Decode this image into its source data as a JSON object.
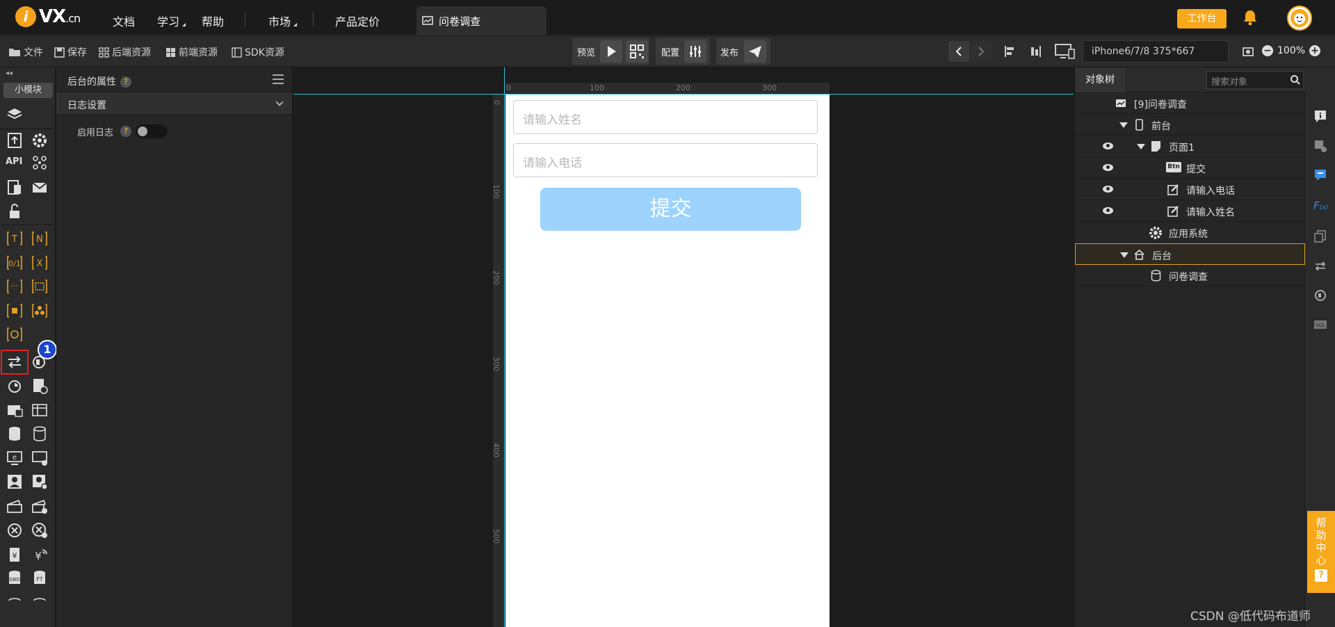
{
  "header": {
    "logo": {
      "mark": "i",
      "text": "VX",
      "suffix": ".cn"
    },
    "nav": [
      {
        "label": "文档"
      },
      {
        "label": "学习"
      },
      {
        "label": "帮助"
      },
      {
        "label": "市场"
      },
      {
        "label": "产品定价"
      }
    ],
    "active_tab": "问卷调查",
    "workbench_label": "工作台"
  },
  "toolbar": {
    "file_label": "文件",
    "save_label": "保存",
    "backend_resources_label": "后端资源",
    "frontend_resources_label": "前端资源",
    "sdk_label": "SDK资源",
    "preview_label": "预览",
    "config_label": "配置",
    "publish_label": "发布",
    "device_value": "iPhone6/7/8 375*667",
    "zoom_value": "100%"
  },
  "left_rail": {
    "collapse_label": "◂◂",
    "mini_module_label": "小模块",
    "api_label": "API",
    "badge_number": "1"
  },
  "properties": {
    "title": "后台的属性",
    "section_title": "日志设置",
    "enable_log_label": "启用日志",
    "enable_log_on": false
  },
  "canvas": {
    "ruler_top_ticks": [
      "0",
      "100",
      "200",
      "300"
    ],
    "ruler_left_ticks": [
      "0",
      "100",
      "200",
      "300",
      "400",
      "500"
    ],
    "name_placeholder": "请输入姓名",
    "phone_placeholder": "请输入电话",
    "submit_label": "提交",
    "colors": {
      "submit_bg": "#9dd3fd",
      "guide": "#2ec4d6"
    }
  },
  "object_tree": {
    "tab_label": "对象树",
    "search_placeholder": "搜索对象",
    "rows": [
      {
        "label": "[9]问卷调查"
      },
      {
        "label": "前台"
      },
      {
        "label": "页面1"
      },
      {
        "label": "提交",
        "icon_text": "Btn"
      },
      {
        "label": "请输入电话"
      },
      {
        "label": "请输入姓名"
      },
      {
        "label": "应用系统"
      },
      {
        "label": "后台"
      },
      {
        "label": "问卷调查"
      }
    ]
  },
  "right_rail": {
    "help_center_label": "帮助中心",
    "help_q": "?"
  },
  "watermark": "CSDN @低代码布道师"
}
